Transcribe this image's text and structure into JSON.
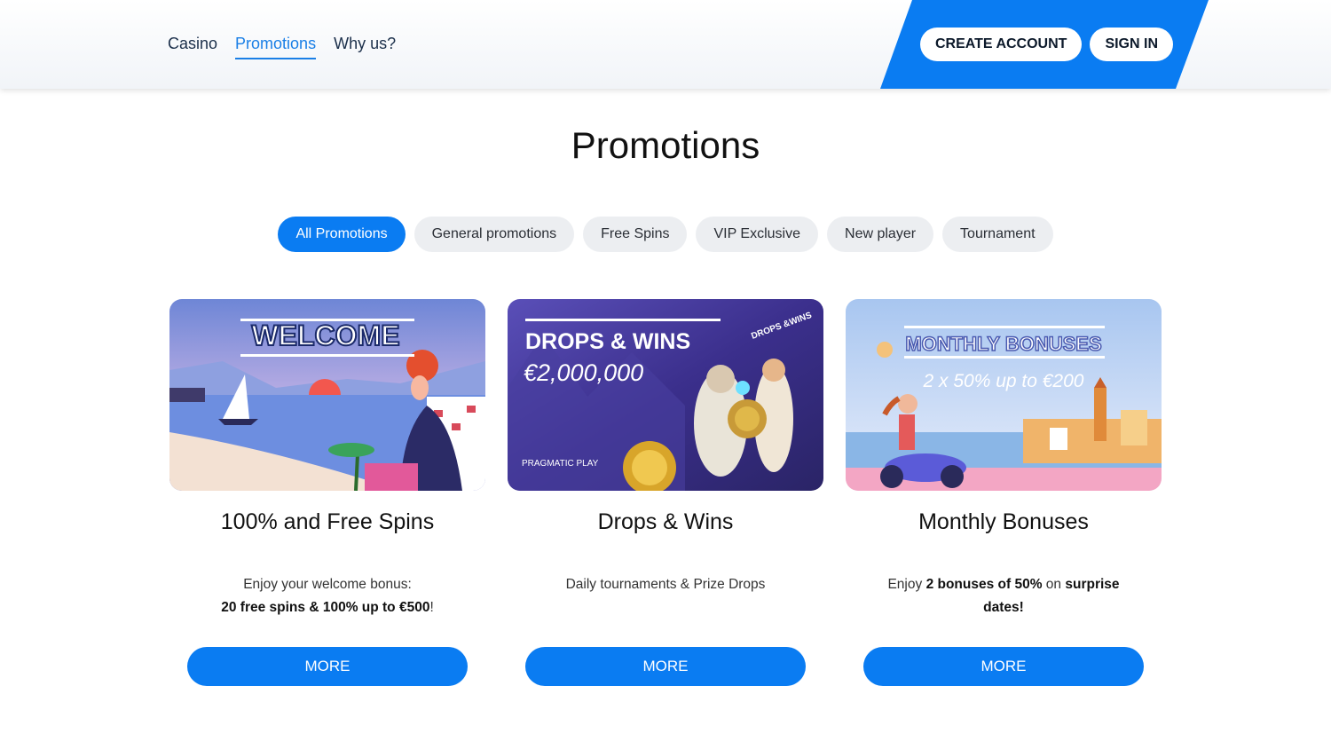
{
  "header": {
    "nav": [
      {
        "label": "Casino",
        "active": false
      },
      {
        "label": "Promotions",
        "active": true
      },
      {
        "label": "Why us?",
        "active": false
      }
    ],
    "create_account": "CREATE ACCOUNT",
    "sign_in": "SIGN IN",
    "accent_color": "#0a7cf2"
  },
  "page_title": "Promotions",
  "filters": [
    {
      "label": "All Promotions",
      "active": true
    },
    {
      "label": "General promotions",
      "active": false
    },
    {
      "label": "Free Spins",
      "active": false
    },
    {
      "label": "VIP Exclusive",
      "active": false
    },
    {
      "label": "New player",
      "active": false
    },
    {
      "label": "Tournament",
      "active": false
    }
  ],
  "cards": [
    {
      "banner_title": "WELCOME",
      "title": "100% and Free Spins",
      "desc_line1": "Enjoy your welcome bonus:",
      "desc_bold": "20 free spins & 100% up to €500",
      "desc_end": "!",
      "button": "MORE"
    },
    {
      "banner_title": "DROPS & WINS",
      "banner_amount": "€2,000,000",
      "banner_logo": "DROPS &WINS",
      "banner_brand": "PRAGMATIC PLAY",
      "title": "Drops & Wins",
      "desc": "Daily tournaments & Prize Drops",
      "button": "MORE"
    },
    {
      "banner_title": "MONTHLY BONUSES",
      "banner_sub": "2 x 50% up to €200",
      "title": "Monthly Bonuses",
      "desc_pre": "Enjoy ",
      "desc_bold1": "2 bonuses of 50%",
      "desc_mid": " on ",
      "desc_bold2": "surprise dates!",
      "button": "MORE"
    }
  ]
}
